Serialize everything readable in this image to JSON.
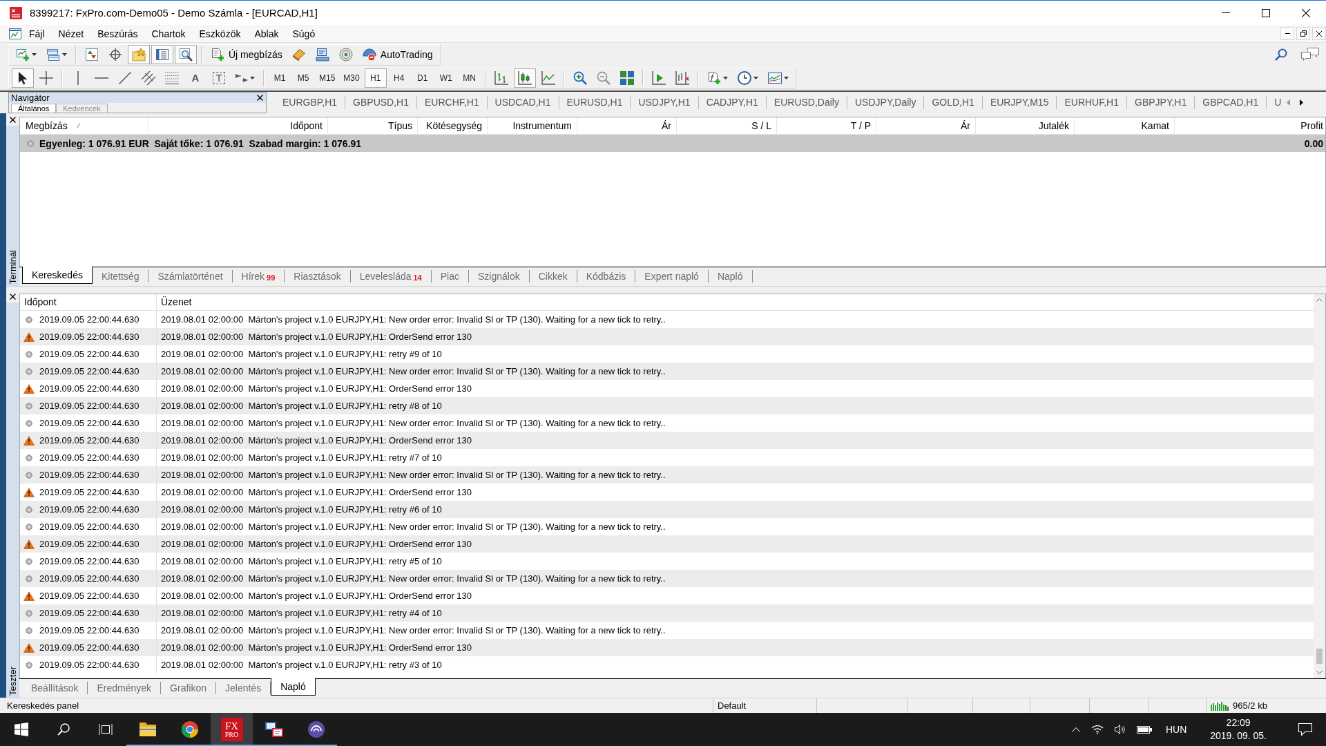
{
  "window": {
    "title": "8399217: FxPro.com-Demo05 - Demo Számla - [EURCAD,H1]"
  },
  "menu": [
    "Fájl",
    "Nézet",
    "Beszúrás",
    "Chartok",
    "Eszközök",
    "Ablak",
    "Súgó"
  ],
  "toolbars": [
    {
      "groups": [
        [
          {
            "kind": "new-chart",
            "pressed": false
          },
          {
            "kind": "profiles",
            "pressed": false
          }
        ],
        [
          {
            "kind": "market-watch",
            "pressed": false
          },
          {
            "kind": "data-window",
            "pressed": false
          },
          {
            "kind": "navigator",
            "pressed": true
          },
          {
            "kind": "terminal",
            "pressed": true
          },
          {
            "kind": "tester",
            "pressed": true
          }
        ],
        [
          {
            "kind": "new-order",
            "label": "Új megbízás",
            "pressed": false
          },
          {
            "kind": "metaeditor",
            "pressed": false
          },
          {
            "kind": "market",
            "pressed": false
          },
          {
            "kind": "signals",
            "pressed": false
          },
          {
            "kind": "autotrading",
            "label": "AutoTrading",
            "pressed": false
          }
        ]
      ]
    },
    {
      "groups": [
        [
          {
            "kind": "cursor",
            "pressed": true
          },
          {
            "kind": "crosshair",
            "pressed": false
          }
        ],
        [
          {
            "kind": "vertical-line",
            "pressed": false
          },
          {
            "kind": "horizontal-line",
            "pressed": false
          },
          {
            "kind": "trend-line",
            "pressed": false
          },
          {
            "kind": "channel",
            "pressed": false
          },
          {
            "kind": "fibonacci",
            "pressed": false
          },
          {
            "kind": "text",
            "glyph": "A",
            "pressed": false
          },
          {
            "kind": "label",
            "glyph": "T",
            "pressed": false
          },
          {
            "kind": "arrows",
            "pressed": false
          }
        ],
        [
          {
            "kind": "timeframe",
            "label": "M1",
            "pressed": false
          },
          {
            "kind": "timeframe",
            "label": "M5",
            "pressed": false
          },
          {
            "kind": "timeframe",
            "label": "M15",
            "pressed": false
          },
          {
            "kind": "timeframe",
            "label": "M30",
            "pressed": false
          },
          {
            "kind": "timeframe",
            "label": "H1",
            "pressed": true
          },
          {
            "kind": "timeframe",
            "label": "H4",
            "pressed": false
          },
          {
            "kind": "timeframe",
            "label": "D1",
            "pressed": false
          },
          {
            "kind": "timeframe",
            "label": "W1",
            "pressed": false
          },
          {
            "kind": "timeframe",
            "label": "MN",
            "pressed": false
          }
        ],
        [
          {
            "kind": "bar-chart",
            "pressed": false
          },
          {
            "kind": "candlesticks",
            "pressed": true
          },
          {
            "kind": "line-chart",
            "pressed": false
          }
        ],
        [
          {
            "kind": "zoom-in",
            "pressed": false
          },
          {
            "kind": "zoom-out",
            "pressed": false
          },
          {
            "kind": "tile",
            "pressed": false
          }
        ],
        [
          {
            "kind": "autoscroll",
            "pressed": false
          },
          {
            "kind": "chart-shift",
            "pressed": false
          }
        ],
        [
          {
            "kind": "indicators",
            "pressed": false
          },
          {
            "kind": "periods",
            "pressed": false
          },
          {
            "kind": "templates",
            "pressed": false
          }
        ]
      ]
    }
  ],
  "navigator": {
    "title": "Navigátor",
    "tabs": [
      {
        "label": "Általános",
        "selected": true
      },
      {
        "label": "Kedvencek",
        "selected": false
      }
    ]
  },
  "chart_tabs": [
    {
      "label": "EURGBP,H1",
      "selected": false
    },
    {
      "label": "GBPUSD,H1",
      "selected": false
    },
    {
      "label": "EURCHF,H1",
      "selected": false
    },
    {
      "label": "USDCAD,H1",
      "selected": false
    },
    {
      "label": "EURUSD,H1",
      "selected": false
    },
    {
      "label": "USDJPY,H1",
      "selected": false
    },
    {
      "label": "CADJPY,H1",
      "selected": false
    },
    {
      "label": "EURUSD,Daily",
      "selected": false
    },
    {
      "label": "USDJPY,Daily",
      "selected": false
    },
    {
      "label": "GOLD,H1",
      "selected": false
    },
    {
      "label": "EURJPY,M15",
      "selected": false
    },
    {
      "label": "EURHUF,H1",
      "selected": false
    },
    {
      "label": "GBPJPY,H1",
      "selected": false
    },
    {
      "label": "GBPCAD,H1",
      "selected": false
    },
    {
      "label": "U",
      "selected": false
    }
  ],
  "terminal": {
    "title": "Terminál",
    "columns": [
      {
        "label": "Megbízás",
        "sorted": true
      },
      {
        "label": "Időpont",
        "sorted": false
      },
      {
        "label": "Típus",
        "sorted": false
      },
      {
        "label": "Kötésegység",
        "sorted": false
      },
      {
        "label": "Instrumentum",
        "sorted": false
      },
      {
        "label": "Ár",
        "sorted": false
      },
      {
        "label": "S / L",
        "sorted": false
      },
      {
        "label": "T / P",
        "sorted": false
      },
      {
        "label": "Ár",
        "sorted": false
      },
      {
        "label": "Jutalék",
        "sorted": false
      },
      {
        "label": "Kamat",
        "sorted": false
      },
      {
        "label": "Profit",
        "sorted": false
      }
    ],
    "summary": "Egyenleg: 1 076.91 EUR  Saját tőke: 1 076.91  Szabad margin: 1 076.91",
    "profit": "0.00",
    "tabs": [
      {
        "label": "Kereskedés",
        "selected": true
      },
      {
        "label": "Kitettség",
        "selected": false
      },
      {
        "label": "Számlatörténet",
        "selected": false
      },
      {
        "label": "Hírek",
        "badge": "99",
        "selected": false
      },
      {
        "label": "Riasztások",
        "selected": false
      },
      {
        "label": "Levelesláda",
        "badge": "14",
        "selected": false
      },
      {
        "label": "Piac",
        "selected": false
      },
      {
        "label": "Szignálok",
        "selected": false
      },
      {
        "label": "Cikkek",
        "selected": false
      },
      {
        "label": "Kódbázis",
        "selected": false
      },
      {
        "label": "Expert napló",
        "selected": false
      },
      {
        "label": "Napló",
        "selected": false
      }
    ]
  },
  "tester": {
    "title": "Teszter",
    "columns": [
      "Időpont",
      "Üzenet"
    ],
    "rows": [
      {
        "kind": "info",
        "time": "2019.09.05 22:00:44.630",
        "message": "2019.08.01 02:00:00  Márton's project v.1.0 EURJPY,H1: New order error: Invalid Sl or TP (130). Waiting for a new tick to retry.."
      },
      {
        "kind": "warning",
        "time": "2019.09.05 22:00:44.630",
        "message": "2019.08.01 02:00:00  Márton's project v.1.0 EURJPY,H1: OrderSend error 130"
      },
      {
        "kind": "info",
        "time": "2019.09.05 22:00:44.630",
        "message": "2019.08.01 02:00:00  Márton's project v.1.0 EURJPY,H1: retry #9 of 10"
      },
      {
        "kind": "info",
        "time": "2019.09.05 22:00:44.630",
        "message": "2019.08.01 02:00:00  Márton's project v.1.0 EURJPY,H1: New order error: Invalid Sl or TP (130). Waiting for a new tick to retry.."
      },
      {
        "kind": "warning",
        "time": "2019.09.05 22:00:44.630",
        "message": "2019.08.01 02:00:00  Márton's project v.1.0 EURJPY,H1: OrderSend error 130"
      },
      {
        "kind": "info",
        "time": "2019.09.05 22:00:44.630",
        "message": "2019.08.01 02:00:00  Márton's project v.1.0 EURJPY,H1: retry #8 of 10"
      },
      {
        "kind": "info",
        "time": "2019.09.05 22:00:44.630",
        "message": "2019.08.01 02:00:00  Márton's project v.1.0 EURJPY,H1: New order error: Invalid Sl or TP (130). Waiting for a new tick to retry.."
      },
      {
        "kind": "warning",
        "time": "2019.09.05 22:00:44.630",
        "message": "2019.08.01 02:00:00  Márton's project v.1.0 EURJPY,H1: OrderSend error 130"
      },
      {
        "kind": "info",
        "time": "2019.09.05 22:00:44.630",
        "message": "2019.08.01 02:00:00  Márton's project v.1.0 EURJPY,H1: retry #7 of 10"
      },
      {
        "kind": "info",
        "time": "2019.09.05 22:00:44.630",
        "message": "2019.08.01 02:00:00  Márton's project v.1.0 EURJPY,H1: New order error: Invalid Sl or TP (130). Waiting for a new tick to retry.."
      },
      {
        "kind": "warning",
        "time": "2019.09.05 22:00:44.630",
        "message": "2019.08.01 02:00:00  Márton's project v.1.0 EURJPY,H1: OrderSend error 130"
      },
      {
        "kind": "info",
        "time": "2019.09.05 22:00:44.630",
        "message": "2019.08.01 02:00:00  Márton's project v.1.0 EURJPY,H1: retry #6 of 10"
      },
      {
        "kind": "info",
        "time": "2019.09.05 22:00:44.630",
        "message": "2019.08.01 02:00:00  Márton's project v.1.0 EURJPY,H1: New order error: Invalid Sl or TP (130). Waiting for a new tick to retry.."
      },
      {
        "kind": "warning",
        "time": "2019.09.05 22:00:44.630",
        "message": "2019.08.01 02:00:00  Márton's project v.1.0 EURJPY,H1: OrderSend error 130"
      },
      {
        "kind": "info",
        "time": "2019.09.05 22:00:44.630",
        "message": "2019.08.01 02:00:00  Márton's project v.1.0 EURJPY,H1: retry #5 of 10"
      },
      {
        "kind": "info",
        "time": "2019.09.05 22:00:44.630",
        "message": "2019.08.01 02:00:00  Márton's project v.1.0 EURJPY,H1: New order error: Invalid Sl or TP (130). Waiting for a new tick to retry.."
      },
      {
        "kind": "warning",
        "time": "2019.09.05 22:00:44.630",
        "message": "2019.08.01 02:00:00  Márton's project v.1.0 EURJPY,H1: OrderSend error 130"
      },
      {
        "kind": "info",
        "time": "2019.09.05 22:00:44.630",
        "message": "2019.08.01 02:00:00  Márton's project v.1.0 EURJPY,H1: retry #4 of 10"
      },
      {
        "kind": "info",
        "time": "2019.09.05 22:00:44.630",
        "message": "2019.08.01 02:00:00  Márton's project v.1.0 EURJPY,H1: New order error: Invalid Sl or TP (130). Waiting for a new tick to retry.."
      },
      {
        "kind": "warning",
        "time": "2019.09.05 22:00:44.630",
        "message": "2019.08.01 02:00:00  Márton's project v.1.0 EURJPY,H1: OrderSend error 130"
      },
      {
        "kind": "info",
        "time": "2019.09.05 22:00:44.630",
        "message": "2019.08.01 02:00:00  Márton's project v.1.0 EURJPY,H1: retry #3 of 10"
      }
    ],
    "tabs": [
      {
        "label": "Beállítások",
        "selected": false
      },
      {
        "label": "Eredmények",
        "selected": false
      },
      {
        "label": "Grafikon",
        "selected": false
      },
      {
        "label": "Jelentés",
        "selected": false
      },
      {
        "label": "Napló",
        "selected": true
      }
    ]
  },
  "status_bar": {
    "panel": "Kereskedés panel",
    "profile": "Default",
    "traffic": "965/2 kb"
  },
  "taskbar": {
    "apps": [
      {
        "kind": "explorer",
        "running": true,
        "active": false
      },
      {
        "kind": "chrome",
        "running": true,
        "active": false
      },
      {
        "kind": "fxpro",
        "logo": [
          "FX",
          "PRO"
        ],
        "running": true,
        "active": true
      },
      {
        "kind": "stack",
        "running": true,
        "active": false
      },
      {
        "kind": "arcs",
        "running": true,
        "active": false
      }
    ],
    "language": "HUN",
    "time": "22:09",
    "date": "2019. 09. 05."
  }
}
